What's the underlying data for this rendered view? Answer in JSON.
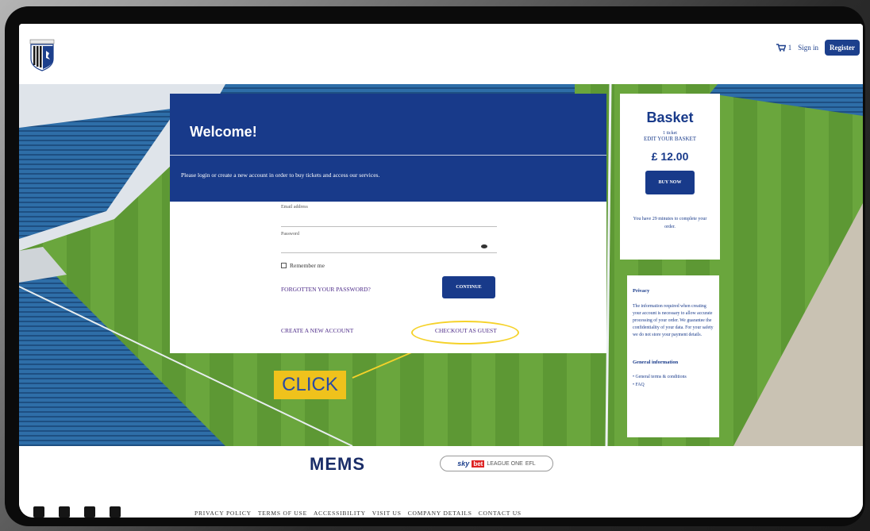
{
  "header": {
    "cart_count": "1",
    "signin_label": "Sign in",
    "register_label": "Register"
  },
  "welcome": {
    "title": "Welcome!",
    "subtitle": "Please login or create a new account in order to buy tickets and access our services.",
    "email_label": "Email address",
    "password_label": "Password",
    "remember_label": "Remember me",
    "forgot_link": "FORGOTTEN YOUR PASSWORD?",
    "continue_label": "CONTINUE",
    "create_link": "CREATE A NEW ACCOUNT",
    "guest_link": "CHECKOUT AS GUEST"
  },
  "annotation": {
    "click_label": "CLICK"
  },
  "basket": {
    "title": "Basket",
    "count": "1 ticket",
    "edit_link": "EDIT YOUR BASKET",
    "price": "£ 12.00",
    "buy_label": "BUY NOW",
    "timer_text": "You have 29 minutes to complete your order."
  },
  "privacy": {
    "title": "Privacy",
    "text": "The information required when creating your account is necessary to allow accurate processing of your order. We guarantee the confidentiality of your data. For your safety we do not store your payment details.",
    "general_title": "General information",
    "general_items": [
      "General terms & conditions",
      "FAQ"
    ]
  },
  "footer": {
    "sponsor_logo": "MEMS",
    "league_sky": "sky",
    "league_bet": "bet",
    "league_text": "LEAGUE ONE",
    "league_efl": "EFL",
    "links": [
      "PRIVACY POLICY",
      "TERMS OF USE",
      "ACCESSIBILITY",
      "VISIT US",
      "COMPANY DETAILS",
      "CONTACT US"
    ]
  },
  "colors": {
    "brand_blue": "#183a8a",
    "highlight_yellow": "#efc21c",
    "link_purple": "#4c2a88"
  }
}
